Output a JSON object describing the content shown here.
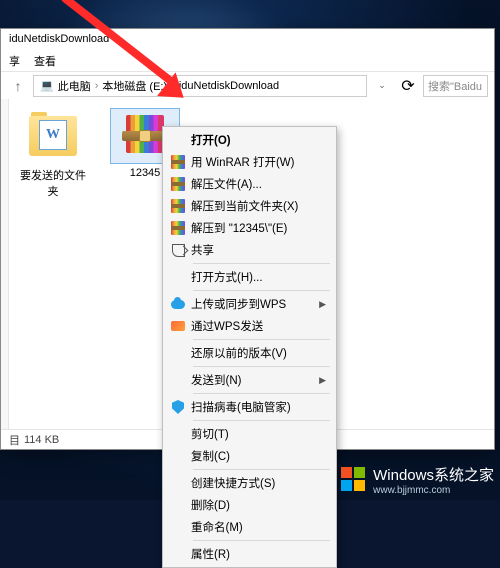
{
  "window": {
    "title": "iduNetdiskDownload",
    "menu": {
      "share": "享",
      "view": "查看"
    }
  },
  "address": {
    "root_label": "此电脑",
    "drive_label": "本地磁盘 (E:)",
    "folder_label": "iduNetdiskDownload",
    "search_placeholder": "搜索\"Baidu"
  },
  "files": [
    {
      "name": "要发送的文件夹",
      "type": "folder",
      "selected": false
    },
    {
      "name": "12345",
      "type": "rar",
      "selected": true
    }
  ],
  "context_menu": {
    "open": "打开(O)",
    "open_winrar": "用 WinRAR 打开(W)",
    "extract_files": "解压文件(A)...",
    "extract_here": "解压到当前文件夹(X)",
    "extract_to": "解压到 \"12345\\\"(E)",
    "share": "共享",
    "open_with": "打开方式(H)...",
    "upload_wps": "上传或同步到WPS",
    "send_wps": "通过WPS发送",
    "restore_version": "还原以前的版本(V)",
    "send_to": "发送到(N)",
    "scan_virus": "扫描病毒(电脑管家)",
    "cut": "剪切(T)",
    "copy": "复制(C)",
    "create_shortcut": "创建快捷方式(S)",
    "delete": "删除(D)",
    "rename": "重命名(M)",
    "properties": "属性(R)"
  },
  "statusbar": {
    "item_count_label": "目",
    "size": "114 KB"
  },
  "watermark": {
    "brand": "Windows",
    "sub": "系统之家",
    "url": "www.bjjmmc.com"
  }
}
